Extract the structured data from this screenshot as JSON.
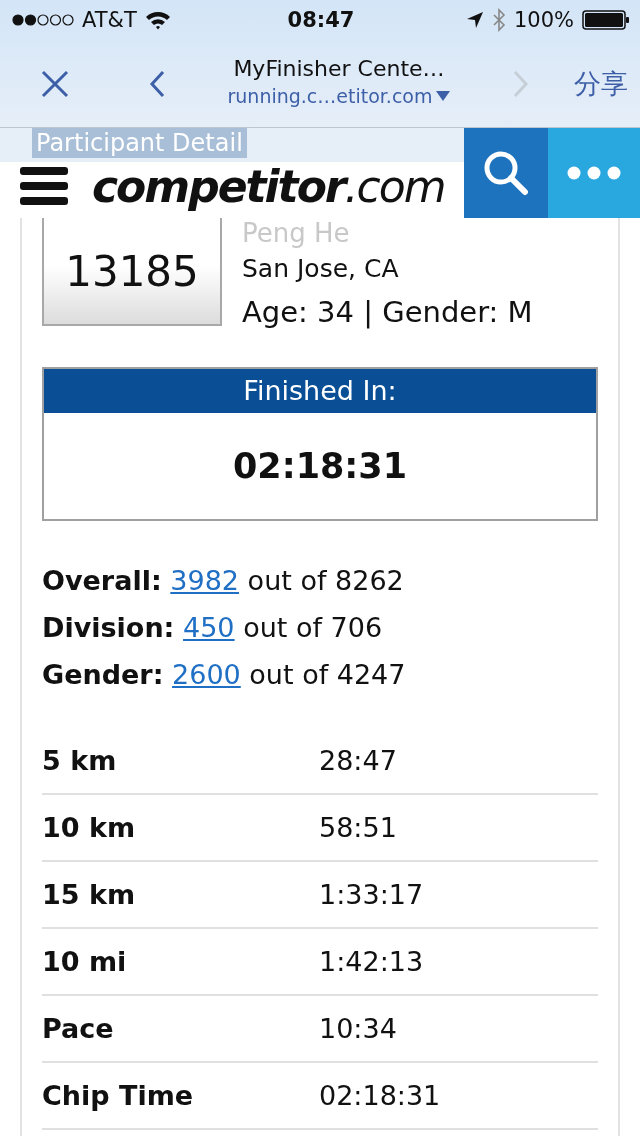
{
  "status_bar": {
    "carrier": "AT&T",
    "time": "08:47",
    "battery": "100%"
  },
  "browser": {
    "title": "MyFinisher Cente…",
    "url": "running.c…etitor.com",
    "back": {
      "disabled": false
    },
    "forward": {
      "disabled": true
    },
    "share": "分享"
  },
  "header": {
    "section_title": "Participant Detail",
    "logo_bold": "competitor",
    "logo_light": ".com"
  },
  "participant": {
    "bib": "13185",
    "name": "Peng He",
    "location": "San Jose, CA",
    "details": "Age: 34 | Gender: M"
  },
  "finish": {
    "label": "Finished In:",
    "time": "02:18:31"
  },
  "rankings": [
    {
      "label": "Overall:",
      "rank": "3982",
      "total": "out of 8262"
    },
    {
      "label": "Division:",
      "rank": "450",
      "total": "out of 706"
    },
    {
      "label": "Gender:",
      "rank": "2600",
      "total": "out of 4247"
    }
  ],
  "splits": [
    {
      "label": "5 km",
      "time": "28:47"
    },
    {
      "label": "10 km",
      "time": "58:51"
    },
    {
      "label": "15 km",
      "time": "1:33:17"
    },
    {
      "label": "10 mi",
      "time": "1:42:13"
    },
    {
      "label": "Pace",
      "time": "10:34"
    },
    {
      "label": "Chip Time",
      "time": "02:18:31"
    }
  ]
}
